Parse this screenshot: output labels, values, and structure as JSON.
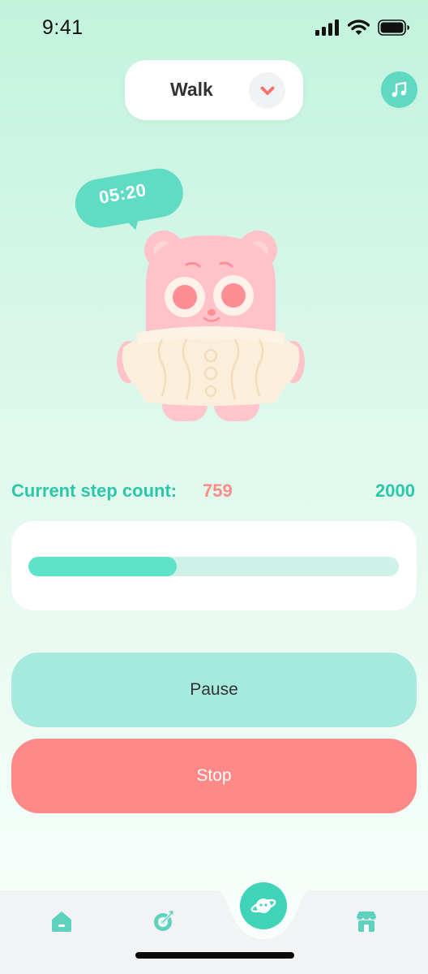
{
  "status_bar": {
    "time": "9:41",
    "icons": [
      "signal-icon",
      "wifi-icon",
      "battery-icon"
    ]
  },
  "mode_selector": {
    "label": "Walk",
    "icon": "chevron-down-icon"
  },
  "music_button": {
    "icon": "music-note-icon"
  },
  "timer": {
    "text": "05:20"
  },
  "step_count": {
    "label": "Current step count:",
    "value": "759",
    "goal": "2000",
    "progress_fraction": 0.4
  },
  "actions": {
    "pause_label": "Pause",
    "stop_label": "Stop"
  },
  "tab_bar": {
    "items": [
      {
        "icon": "home-icon"
      },
      {
        "icon": "target-icon"
      },
      {
        "icon": "planet-icon",
        "active": true
      },
      {
        "icon": "store-icon"
      }
    ]
  },
  "colors": {
    "accent": "#2cc7a9",
    "accent_light": "#5ee2c9",
    "coral": "#fe8986",
    "pause_button": "#a6e9dd",
    "progress_track": "#cff1e8"
  }
}
